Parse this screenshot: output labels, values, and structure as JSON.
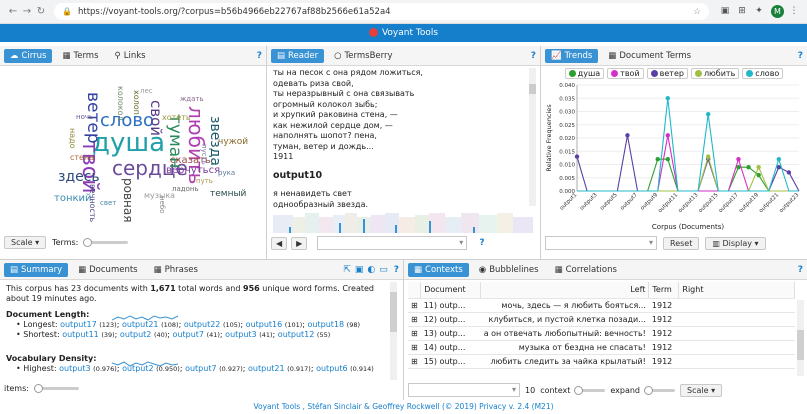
{
  "browser": {
    "url": "https://voyant-tools.org/?corpus=b56b4966eb22767af88b2566e61a52a4",
    "avatar": "M"
  },
  "app": {
    "title": "Voyant Tools"
  },
  "cirrus": {
    "tabs": [
      "Cirrus",
      "Terms",
      "Links"
    ],
    "scale_label": "Scale",
    "terms_label": "Terms:",
    "words": [
      {
        "t": "душа",
        "c": "#20a0a8"
      },
      {
        "t": "слово",
        "c": "#2a6fc0"
      },
      {
        "t": "сердце",
        "c": "#6a4a9a"
      },
      {
        "t": "твой",
        "c": "#8a3bb8"
      },
      {
        "t": "ветер",
        "c": "#3040a0"
      },
      {
        "t": "любить",
        "c": "#b040b0"
      },
      {
        "t": "туман",
        "c": "#2a8a5a"
      },
      {
        "t": "свой",
        "c": "#5a3a8a"
      },
      {
        "t": "здесь",
        "c": "#2a4a7a"
      },
      {
        "t": "звезда",
        "c": "#1a5a6a"
      },
      {
        "t": "вернуться",
        "c": "#7a3a9a"
      },
      {
        "t": "сказать",
        "c": "#9a4a4a"
      },
      {
        "t": "ровная",
        "c": "#444"
      },
      {
        "t": "холоп",
        "c": "#6a6a2a"
      },
      {
        "t": "чужой",
        "c": "#8a6a2a"
      },
      {
        "t": "хотеть",
        "c": "#9a9a3a"
      },
      {
        "t": "темный",
        "c": "#2a4a4a"
      },
      {
        "t": "тонкий",
        "c": "#3a8ab0"
      },
      {
        "t": "вечность",
        "c": "#4a4a8a"
      },
      {
        "t": "музыка",
        "c": "#9a9a9a"
      },
      {
        "t": "надо",
        "c": "#8a8a3a"
      },
      {
        "t": "пусть",
        "c": "#7a7ab0"
      },
      {
        "t": "колокол",
        "c": "#6a8a6a"
      },
      {
        "t": "стена",
        "c": "#aa6a3a"
      },
      {
        "t": "небо",
        "c": "#888"
      },
      {
        "t": "ладонь",
        "c": "#6a6a6a"
      },
      {
        "t": "рука",
        "c": "#5a7a9a"
      },
      {
        "t": "лес",
        "c": "#9a9a9a"
      },
      {
        "t": "путь",
        "c": "#aa9a4a"
      },
      {
        "t": "свет",
        "c": "#4a8aaa"
      },
      {
        "t": "ночь",
        "c": "#6a5a9a"
      },
      {
        "t": "ждать",
        "c": "#8a6a8a"
      }
    ]
  },
  "reader": {
    "tabs": [
      "Reader",
      "TermsBerry"
    ],
    "lines": [
      "ты на песок с она рядом ложиться,",
      "одевать риза свой,",
      "ты неразрывный с она связывать",
      "огромный колокол зыбь;",
      "и хрупкий раковина стена, —",
      "как нежилой сердце дом, —",
      "наполнять шопот? пена,",
      "туман, ветер и дождь...",
      "1911"
    ],
    "heading": "output10",
    "lines2": [
      "я ненавидеть свет",
      "однообразный звезда."
    ]
  },
  "trends": {
    "tabs": [
      "Trends",
      "Document Terms"
    ],
    "reset_label": "Reset",
    "display_label": "Display"
  },
  "chart_data": {
    "type": "line",
    "ylabel": "Relative Frequencies",
    "xlabel": "Corpus (Documents)",
    "ylim": [
      0,
      0.04
    ],
    "yticks": [
      "0.000",
      "0.005",
      "0.010",
      "0.015",
      "0.020",
      "0.025",
      "0.030",
      "0.035",
      "0.040"
    ],
    "categories": [
      "output1",
      "output2",
      "output3",
      "output4",
      "output5",
      "output6",
      "output7",
      "output8",
      "output9",
      "output10",
      "output11",
      "output12",
      "output13",
      "output14",
      "output15",
      "output16",
      "output17",
      "output18",
      "output19",
      "output20",
      "output21",
      "output22",
      "output23"
    ],
    "xticks": [
      "output1",
      "output3",
      "output5",
      "output7",
      "output9",
      "output11",
      "output13",
      "output15",
      "output17",
      "output19",
      "output21",
      "output23"
    ],
    "series": [
      {
        "name": "душа",
        "color": "#2ca02c",
        "values": [
          0,
          0,
          0,
          0,
          0,
          0,
          0,
          0,
          0.012,
          0.012,
          0,
          0,
          0,
          0,
          0,
          0,
          0.009,
          0.009,
          0.006,
          0,
          0,
          0,
          0
        ]
      },
      {
        "name": "твой",
        "color": "#d62fc6",
        "values": [
          0,
          0,
          0,
          0,
          0,
          0,
          0,
          0,
          0,
          0.021,
          0,
          0,
          0,
          0,
          0,
          0,
          0.012,
          0,
          0,
          0,
          0,
          0,
          0
        ]
      },
      {
        "name": "ветер",
        "color": "#5a3fa5",
        "values": [
          0.013,
          0,
          0,
          0,
          0,
          0.021,
          0,
          0,
          0,
          0,
          0,
          0,
          0,
          0.012,
          0,
          0,
          0,
          0,
          0,
          0,
          0.009,
          0.007,
          0
        ]
      },
      {
        "name": "любить",
        "color": "#a0c040",
        "values": [
          0,
          0,
          0,
          0,
          0,
          0,
          0,
          0,
          0,
          0,
          0,
          0,
          0,
          0.013,
          0,
          0,
          0,
          0,
          0.009,
          0,
          0,
          0,
          0
        ]
      },
      {
        "name": "слово",
        "color": "#20b8c8",
        "values": [
          0,
          0,
          0,
          0,
          0,
          0,
          0,
          0,
          0,
          0.035,
          0,
          0,
          0,
          0.029,
          0,
          0,
          0,
          0,
          0,
          0,
          0.012,
          0,
          0
        ]
      }
    ]
  },
  "summary": {
    "tabs": [
      "Summary",
      "Documents",
      "Phrases"
    ],
    "intro_a": "This corpus has 23 documents with ",
    "total_words": "1,671",
    "intro_b": " total words and ",
    "unique_forms": "956",
    "intro_c": " unique word forms. Created about 19 minutes ago.",
    "doc_length_label": "Document Length:",
    "longest_label": "Longest:",
    "longest": [
      {
        "d": "output17",
        "n": "(123)"
      },
      {
        "d": "output21",
        "n": "(108)"
      },
      {
        "d": "output22",
        "n": "(105)"
      },
      {
        "d": "output16",
        "n": "(101)"
      },
      {
        "d": "output18",
        "n": "(98)"
      }
    ],
    "shortest_label": "Shortest:",
    "shortest": [
      {
        "d": "output11",
        "n": "(39)"
      },
      {
        "d": "output2",
        "n": "(40)"
      },
      {
        "d": "output7",
        "n": "(41)"
      },
      {
        "d": "output3",
        "n": "(41)"
      },
      {
        "d": "output12",
        "n": "(55)"
      }
    ],
    "vocab_label": "Vocabulary Density:",
    "highest_label": "Highest:",
    "highest": [
      {
        "d": "output3",
        "n": "(0.976)"
      },
      {
        "d": "output2",
        "n": "(0.950)"
      },
      {
        "d": "output7",
        "n": "(0.927)"
      },
      {
        "d": "output21",
        "n": "(0.917)"
      },
      {
        "d": "output6",
        "n": "(0.914)"
      }
    ],
    "items_label": "items:"
  },
  "contexts": {
    "tabs": [
      "Contexts",
      "Bubblelines",
      "Correlations"
    ],
    "columns": {
      "document": "Document",
      "left": "Left",
      "term": "Term",
      "right": "Right"
    },
    "rows": [
      {
        "doc": "11) outp...",
        "left": "мочь, здесь — я любить бояться...",
        "term": "1912"
      },
      {
        "doc": "12) outp...",
        "left": "клубиться, и пустой клетка позади...",
        "term": "1912"
      },
      {
        "doc": "13) outp...",
        "left": "а он отвечать любопытный: вечность!",
        "term": "1912"
      },
      {
        "doc": "14) outp...",
        "left": "музыка от бездна не спасать!",
        "term": "1912"
      },
      {
        "doc": "15) outp...",
        "left": "любить следить за чайка крылатый!",
        "term": "1912"
      }
    ],
    "context_value": "10",
    "context_label": "context",
    "expand_label": "expand",
    "scale_label": "Scale"
  },
  "footer": {
    "text": "Voyant Tools , Stéfan Sinclair & Geoffrey Rockwell (© 2019) Privacy v. 2.4 (M21)"
  }
}
